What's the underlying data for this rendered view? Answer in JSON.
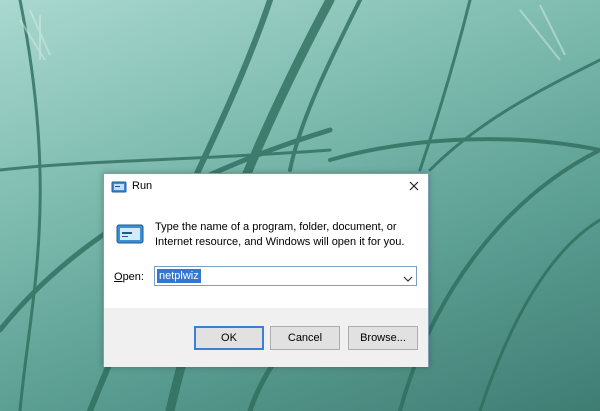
{
  "dialog": {
    "title": "Run",
    "title_icon": "run-icon",
    "close_icon": "close-icon",
    "message": "Type the name of a program, folder, document, or Internet resource, and Windows will open it for you.",
    "message_icon": "run-icon",
    "open_label_accel": "O",
    "open_label_rest": "pen:",
    "open_value": "netplwiz",
    "dropdown_icon": "chevron-down-icon",
    "buttons": {
      "ok": "OK",
      "cancel": "Cancel",
      "browse": "Browse..."
    },
    "colors": {
      "selection": "#3476d2",
      "default_button_border": "#3c7fd3"
    }
  }
}
